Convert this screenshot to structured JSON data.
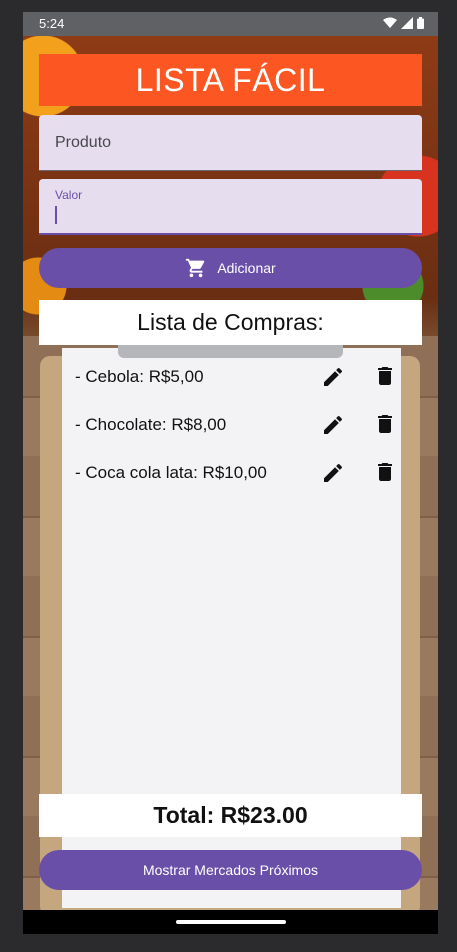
{
  "status_bar": {
    "time": "5:24"
  },
  "app": {
    "title": "LISTA FÁCIL"
  },
  "form": {
    "produto_placeholder": "Produto",
    "valor_label": "Valor",
    "valor_value": "",
    "add_label": "Adicionar"
  },
  "list": {
    "title": "Lista de Compras:",
    "items": [
      {
        "label": "- Cebola: R$5,00"
      },
      {
        "label": "- Chocolate: R$8,00"
      },
      {
        "label": "- Coca cola lata: R$10,00"
      }
    ]
  },
  "total": "Total: R$23.00",
  "mercados_label": "Mostrar Mercados Próximos",
  "colors": {
    "header": "#fc5722",
    "accent": "#6a4fa8",
    "field_bg": "#e6deee"
  },
  "icons": {
    "cart": "shopping-cart-icon",
    "edit": "pencil-icon",
    "delete": "trash-icon"
  }
}
